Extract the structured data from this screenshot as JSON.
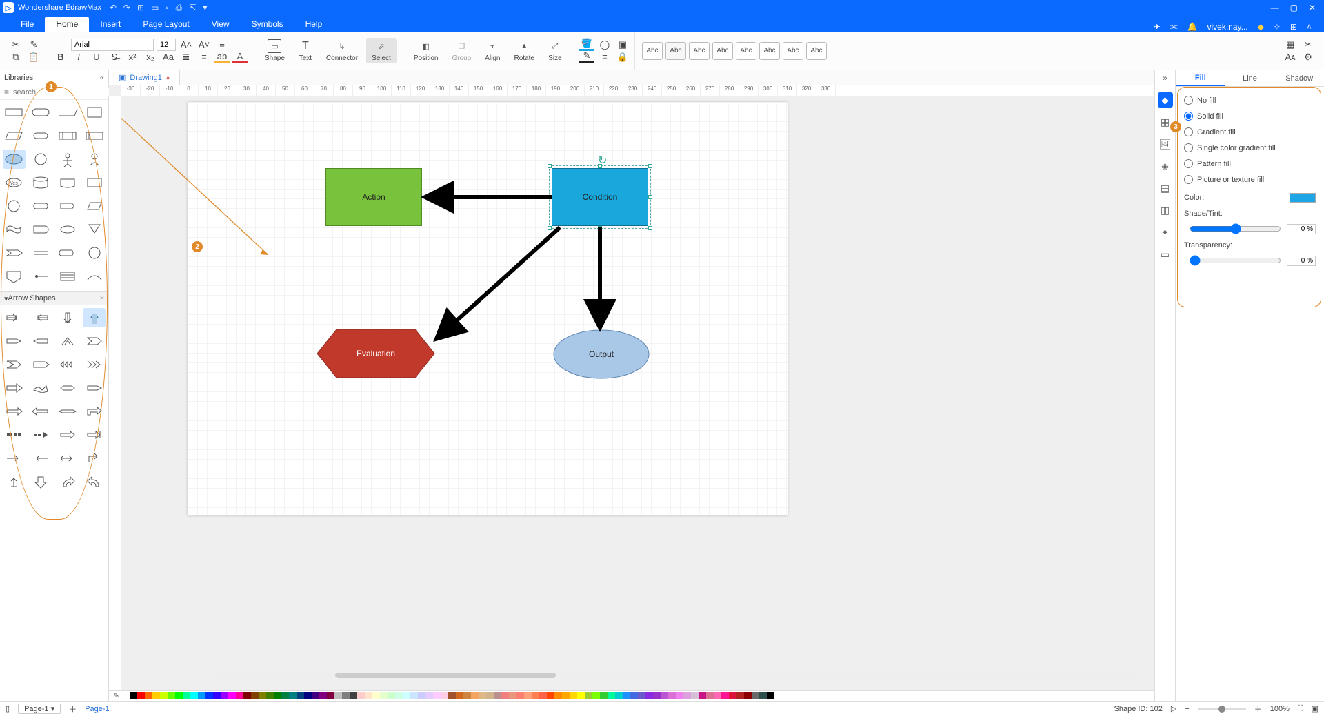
{
  "app_title": "Wondershare EdrawMax",
  "menu": {
    "file": "File",
    "home": "Home",
    "insert": "Insert",
    "page_layout": "Page Layout",
    "view": "View",
    "symbols": "Symbols",
    "help": "Help"
  },
  "user_label": "vivek.nay...",
  "ribbon": {
    "font_name": "Arial",
    "font_size": "12",
    "shape": "Shape",
    "text": "Text",
    "connector": "Connector",
    "select": "Select",
    "position": "Position",
    "group": "Group",
    "align": "Align",
    "rotate": "Rotate",
    "size": "Size",
    "abc": "Abc"
  },
  "libraries": {
    "title": "Libraries",
    "search_placeholder": "search",
    "arrow_section": "Arrow Shapes"
  },
  "document": {
    "tab_name": "Drawing1",
    "page_name": "Page-1"
  },
  "canvas_shapes": {
    "action": "Action",
    "condition": "Condition",
    "evaluation": "Evaluation",
    "output": "Output"
  },
  "annotations": {
    "b1": "1",
    "b2": "2",
    "b3": "3"
  },
  "prop": {
    "tab_fill": "Fill",
    "tab_line": "Line",
    "tab_shadow": "Shadow",
    "no_fill": "No fill",
    "solid_fill": "Solid fill",
    "gradient_fill": "Gradient fill",
    "single_color_gradient": "Single color gradient fill",
    "pattern_fill": "Pattern fill",
    "picture_fill": "Picture or texture fill",
    "color_label": "Color:",
    "shade_label": "Shade/Tint:",
    "transparency_label": "Transparency:",
    "shade_value": "0 %",
    "transparency_value": "0 %"
  },
  "status": {
    "page_label": "Page-1",
    "page_tab": "Page-1",
    "shape_id": "Shape ID: 102",
    "zoom": "100%"
  },
  "ruler_marks": [
    "-30",
    "-20",
    "-10",
    "0",
    "10",
    "20",
    "30",
    "40",
    "50",
    "60",
    "70",
    "80",
    "90",
    "100",
    "110",
    "120",
    "130",
    "140",
    "150",
    "160",
    "170",
    "180",
    "190",
    "200",
    "210",
    "220",
    "230",
    "240",
    "250",
    "260",
    "270",
    "280",
    "290",
    "300",
    "310",
    "320",
    "330"
  ],
  "palette": [
    "#ffffff",
    "#000000",
    "#ff0000",
    "#ff6600",
    "#ffcc00",
    "#ccff00",
    "#66ff00",
    "#00ff00",
    "#00ff99",
    "#00ffff",
    "#0099ff",
    "#0033ff",
    "#3300ff",
    "#9900ff",
    "#ff00ff",
    "#ff0099",
    "#800000",
    "#804000",
    "#808000",
    "#408000",
    "#008000",
    "#008040",
    "#008080",
    "#004080",
    "#000080",
    "#400080",
    "#800080",
    "#800040",
    "#c0c0c0",
    "#808080",
    "#404040",
    "#ffcccc",
    "#ffe5cc",
    "#ffffcc",
    "#e5ffcc",
    "#ccffcc",
    "#ccffe5",
    "#ccffff",
    "#cce5ff",
    "#ccccff",
    "#e5ccff",
    "#ffccff",
    "#ffcce5",
    "#a0522d",
    "#d2691e",
    "#cd853f",
    "#f4a460",
    "#deb887",
    "#d2b48c",
    "#bc8f8f",
    "#f08080",
    "#e9967a",
    "#fa8072",
    "#ffa07a",
    "#ff7f50",
    "#ff6347",
    "#ff4500",
    "#ff8c00",
    "#ffa500",
    "#ffd700",
    "#ffff00",
    "#9acd32",
    "#7cfc00",
    "#32cd32",
    "#00fa9a",
    "#00ced1",
    "#1e90ff",
    "#4169e1",
    "#6a5acd",
    "#8a2be2",
    "#9932cc",
    "#ba55d3",
    "#da70d6",
    "#ee82ee",
    "#dda0dd",
    "#d8bfd8",
    "#c71585",
    "#db7093",
    "#ff69b4",
    "#ff1493",
    "#dc143c",
    "#b22222",
    "#8b0000",
    "#696969",
    "#2f4f4f",
    "#000000"
  ]
}
